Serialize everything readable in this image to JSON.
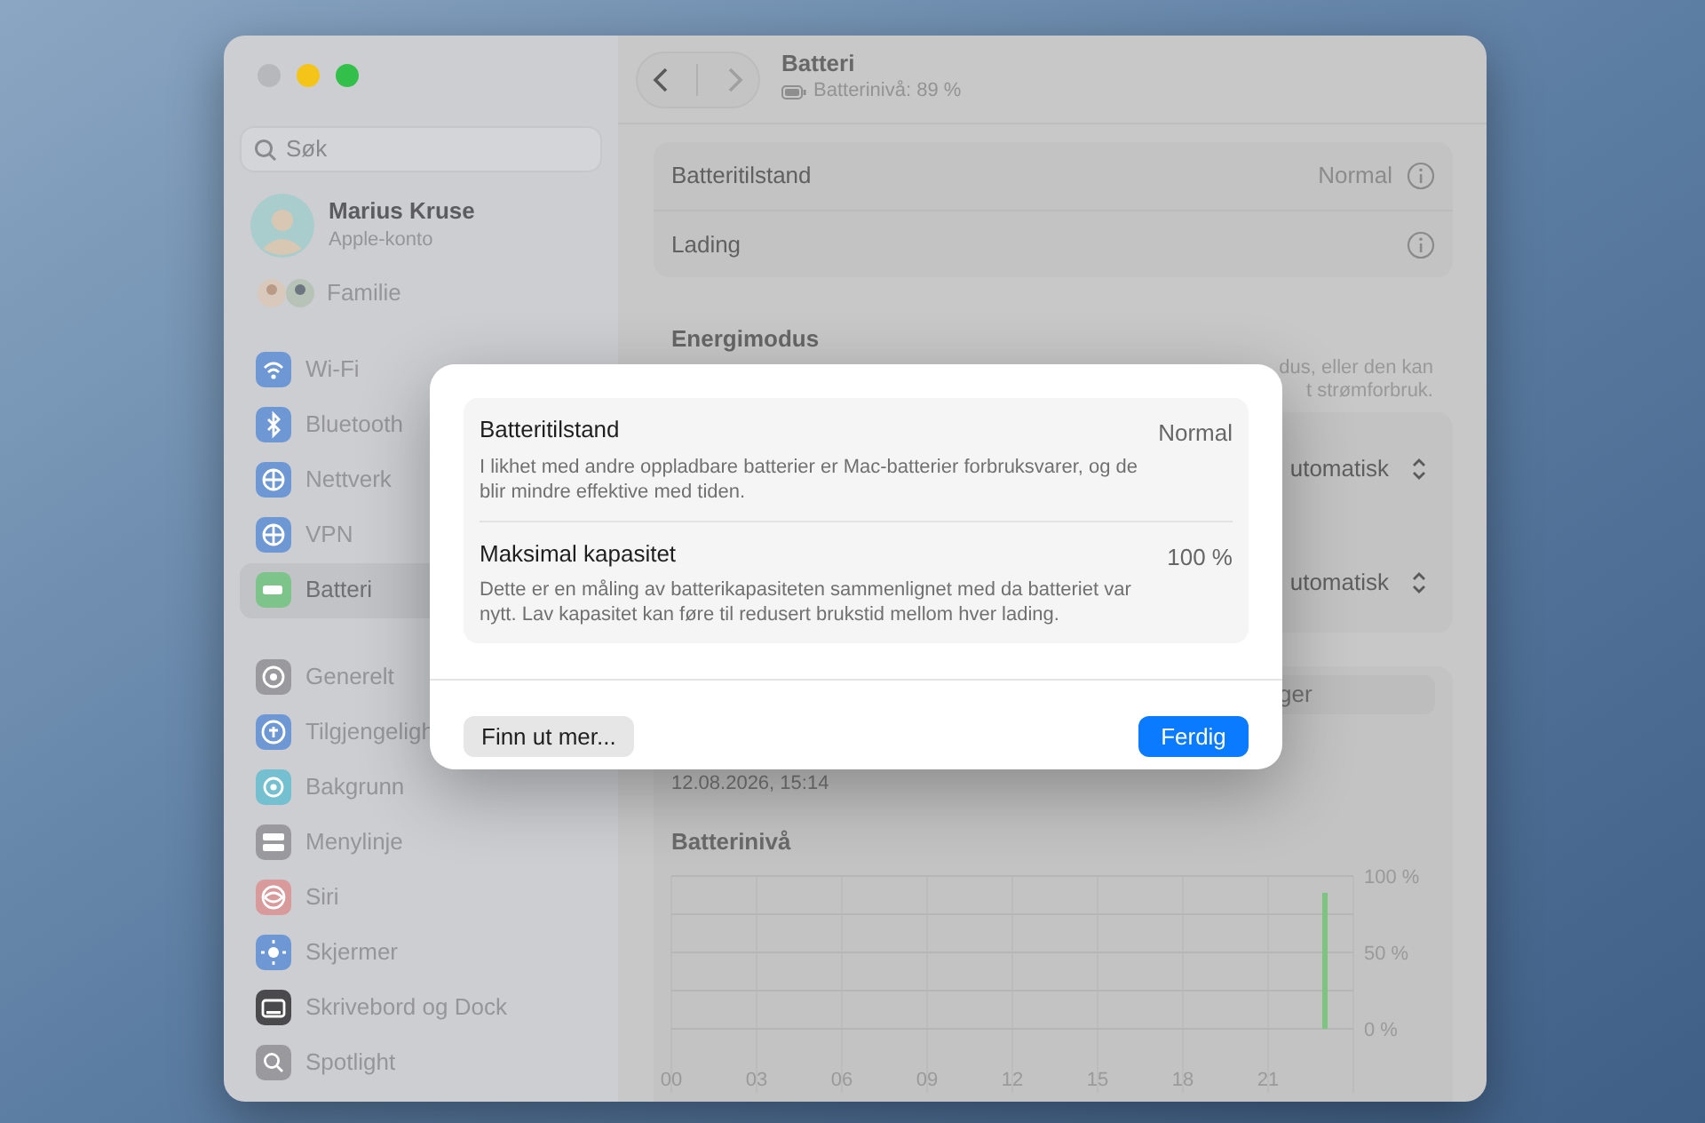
{
  "sidebar": {
    "search": {
      "placeholder": "Søk"
    },
    "account": {
      "name": "Marius Kruse",
      "subtitle": "Apple-konto"
    },
    "family": {
      "label": "Familie"
    },
    "groups": [
      [
        {
          "label": "Wi-Fi",
          "selected": false,
          "color": "#6e98d4"
        },
        {
          "label": "Bluetooth",
          "selected": false,
          "color": "#6e98d4"
        },
        {
          "label": "Nettverk",
          "selected": false,
          "color": "#6e98d4"
        },
        {
          "label": "VPN",
          "selected": false,
          "color": "#6e98d4"
        },
        {
          "label": "Batteri",
          "selected": true,
          "color": "#7dc48a"
        }
      ],
      [
        {
          "label": "Generelt",
          "selected": false,
          "color": "#9a9a9e"
        },
        {
          "label": "Tilgjengeligh",
          "selected": false,
          "color": "#6e98d4"
        },
        {
          "label": "Bakgrunn",
          "selected": false,
          "color": "#74bfd0"
        },
        {
          "label": "Menylinje",
          "selected": false,
          "color": "#9a9a9e"
        },
        {
          "label": "Siri",
          "selected": false,
          "color": "#d89a9a"
        },
        {
          "label": "Skjermer",
          "selected": false,
          "color": "#6e98d4"
        },
        {
          "label": "Skrivebord og Dock",
          "selected": false,
          "color": "#4a4a4c"
        },
        {
          "label": "Spotlight",
          "selected": false,
          "color": "#9a9a9e"
        }
      ]
    ]
  },
  "header": {
    "title": "Batteri",
    "subtitle": "Batterinivå: 89 %"
  },
  "status_card": {
    "rows": [
      {
        "label": "Batteritilstand",
        "value": "Normal"
      },
      {
        "label": "Lading"
      }
    ]
  },
  "energy_mode": {
    "heading": "Energimodus",
    "description_fragments": [
      "dus, eller den kan",
      "t strømforbruk."
    ],
    "selects": [
      {
        "value": "utomatisk"
      },
      {
        "value": "utomatisk"
      }
    ]
  },
  "segment": {
    "label": "ger"
  },
  "timestamp": "12.08.2026, 15:14",
  "chart": {
    "chart_data": {
      "type": "bar",
      "title": "Batterinivå",
      "grid": true,
      "x": [
        23
      ],
      "series": [
        {
          "color": "#7cc47f",
          "values": [
            89
          ]
        }
      ],
      "xlim": [
        0,
        24
      ],
      "ylim": [
        0,
        100
      ],
      "xticks": [
        {
          "value": 0,
          "label": "00"
        },
        {
          "value": 3,
          "label": "03"
        },
        {
          "value": 6,
          "label": "06"
        },
        {
          "value": 9,
          "label": "09"
        },
        {
          "value": 12,
          "label": "12"
        },
        {
          "value": 15,
          "label": "15"
        },
        {
          "value": 18,
          "label": "18"
        },
        {
          "value": 21,
          "label": "21"
        }
      ],
      "yticks": [
        {
          "value": 0,
          "label": "0 %"
        },
        {
          "value": 50,
          "label": "50 %"
        },
        {
          "value": 100,
          "label": "100 %"
        }
      ]
    }
  },
  "dialog": {
    "rows": [
      {
        "title": "Batteritilstand",
        "value": "Normal",
        "description": "I likhet med andre oppladbare batterier er Mac-batterier forbruksvarer, og de blir mindre effektive med tiden."
      },
      {
        "title": "Maksimal kapasitet",
        "value": "100 %",
        "description": "Dette er en måling av batterikapasiteten sammenlignet med da batteriet var nytt. Lav kapasitet kan føre til redusert brukstid mellom hver lading."
      }
    ],
    "buttons": [
      {
        "label": "Finn ut mer...",
        "kind": "secondary"
      },
      {
        "label": "Ferdig",
        "kind": "primary"
      }
    ]
  }
}
